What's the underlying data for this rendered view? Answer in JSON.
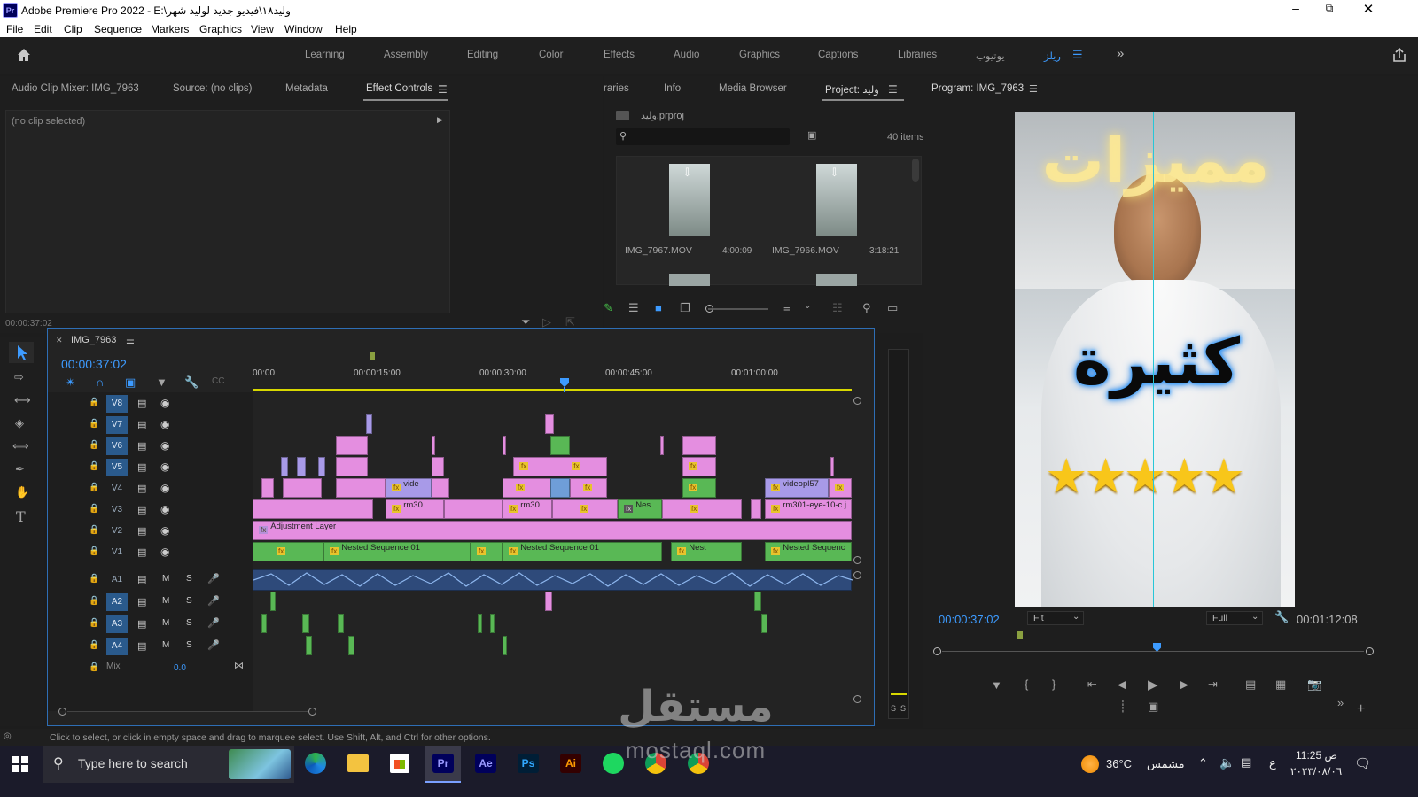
{
  "window": {
    "title": "Adobe Premiere Pro 2022 - E:\\وليد١٨\\فيديو جديد لوليد شهر",
    "app_icon": "Pr"
  },
  "menu": [
    "File",
    "Edit",
    "Clip",
    "Sequence",
    "Markers",
    "Graphics",
    "View",
    "Window",
    "Help"
  ],
  "workspaces": [
    "Learning",
    "Assembly",
    "Editing",
    "Color",
    "Effects",
    "Audio",
    "Graphics",
    "Captions",
    "Libraries",
    "يوتيوب",
    "ريلز"
  ],
  "active_workspace": "ريلز",
  "source_panel": {
    "tabs": [
      "Audio Clip Mixer: IMG_7963",
      "Source: (no clips)",
      "Metadata",
      "Effect Controls"
    ],
    "active_tab": "Effect Controls",
    "no_clip_text": "(no clip selected)",
    "timecode": "00:00:37:02"
  },
  "project_panel": {
    "tabs": [
      "raries",
      "Info",
      "Media Browser",
      "Project: وليد"
    ],
    "active_tab": "Project: وليد",
    "project_file": "وليد.prproj",
    "item_count": "40 items",
    "items": [
      {
        "name": "IMG_7967.MOV",
        "duration": "4:00:09"
      },
      {
        "name": "IMG_7966.MOV",
        "duration": "3:18:21"
      }
    ]
  },
  "program_monitor": {
    "title": "Program: IMG_7963",
    "timecode": "00:00:37:02",
    "duration": "00:01:12:08",
    "fit": "Fit",
    "quality": "Full",
    "overlay_text_top": "مميزات",
    "overlay_text_mid": "كثيرة",
    "stars": 5
  },
  "timeline": {
    "sequence_name": "IMG_7963",
    "timecode": "00:00:37:02",
    "ruler": [
      "00:00",
      "00:00:15:00",
      "00:00:30:00",
      "00:00:45:00",
      "00:01:00:00"
    ],
    "video_tracks": [
      "V8",
      "V7",
      "V6",
      "V5",
      "V4",
      "V3",
      "V2",
      "V1"
    ],
    "audio_tracks": [
      "A1",
      "A2",
      "A3",
      "A4"
    ],
    "mix_label": "Mix",
    "mix_value": "0.0",
    "clip_labels": {
      "vide": "vide",
      "rm30a": "rm30",
      "rm30b": "rm30",
      "nes": "Nes",
      "videopl57": "videopl57",
      "rm301": "rm301-eye-10-c.j",
      "adjust": "Adjustment Layer",
      "nested1": "Nested Sequence 01",
      "nested2": "Nested Sequence 01",
      "nest": "Nest",
      "nested3": "Nested Sequenc"
    },
    "audio_level_labels": [
      "S",
      "S"
    ]
  },
  "statusbar": {
    "text": "Click to select, or click in empty space and drag to marquee select. Use Shift, Alt, and Ctrl for other options."
  },
  "taskbar": {
    "search_placeholder": "Type here to search",
    "weather_temp": "36°C",
    "weather_text": "مشمس",
    "lang": "ع",
    "time": "11:25 ص",
    "date": "٢٠٢٣/٠٨/٠٦",
    "apps": [
      "Pr",
      "Ae",
      "Ps",
      "Ai"
    ]
  },
  "watermark": {
    "brand": "مستقل",
    "domain": "mostaql.com"
  },
  "colors": {
    "accent_blue": "#3d9bff",
    "pink_clip": "#e48ee0",
    "green_clip": "#59b855",
    "audio_wave": "#4d7fc7"
  }
}
